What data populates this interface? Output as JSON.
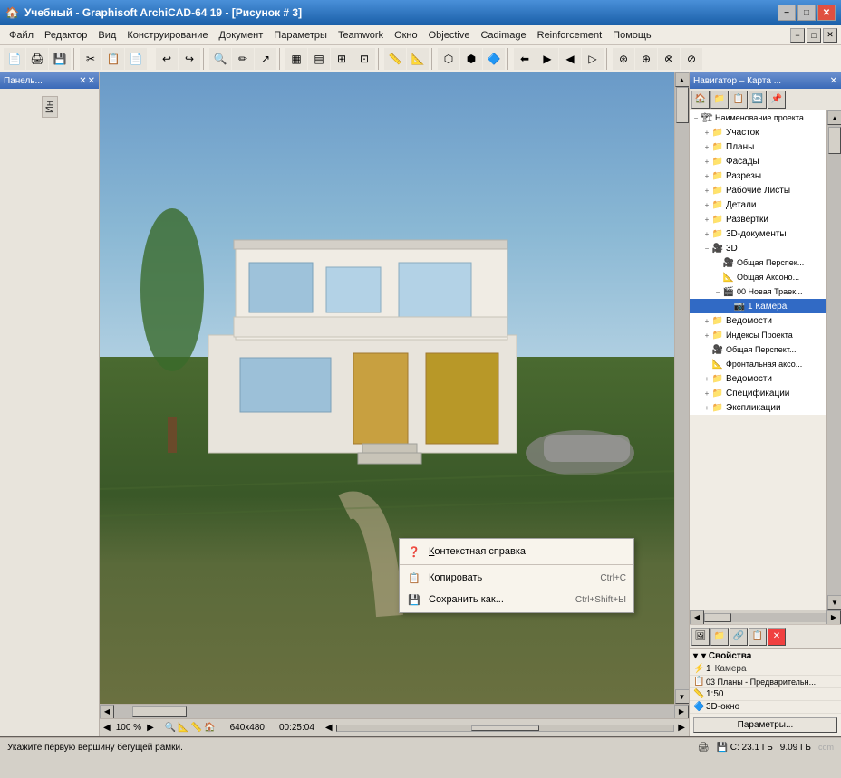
{
  "titleBar": {
    "title": "Учебный - Graphisoft ArchiCAD-64 19 - [Рисунок # 3]",
    "icon": "🏠",
    "controls": [
      "−",
      "□",
      "✕"
    ]
  },
  "menuBar": {
    "items": [
      "Файл",
      "Редактор",
      "Вид",
      "Конструирование",
      "Документ",
      "Параметры",
      "Teamwork",
      "Окно",
      "Objective",
      "Cadimage",
      "Reinforcement",
      "Помощь"
    ],
    "controls": [
      "−",
      "□",
      "✕"
    ]
  },
  "toolbar": {
    "groups": [
      {
        "icons": [
          "📄",
          "🖨",
          "💾"
        ]
      },
      {
        "icons": [
          "✂",
          "📋",
          "📄"
        ]
      },
      {
        "icons": [
          "↩",
          "↪"
        ]
      },
      {
        "icons": [
          "🔍",
          "✏",
          "↗"
        ]
      },
      {
        "icons": [
          "📐",
          "📏",
          "⊞",
          "⊡",
          "▦",
          "▤"
        ]
      },
      {
        "icons": [
          "📊",
          "📈"
        ]
      },
      {
        "icons": [
          "⬡",
          "⬢",
          "🔷"
        ]
      },
      {
        "icons": [
          "⬅",
          "▶",
          "◀",
          "▷"
        ]
      }
    ]
  },
  "leftPanel": {
    "title": "Панель...",
    "verticalText": "Ин"
  },
  "canvas": {
    "zoomLevel": "100 %",
    "dimensions": "640x480",
    "time": "00:25:04"
  },
  "contextMenu": {
    "items": [
      {
        "icon": "❓",
        "label": "Контекстная справка",
        "labelPrefix": "К",
        "shortcut": "",
        "underline": true
      },
      {
        "icon": "📋",
        "label": "Копировать",
        "shortcut": "Ctrl+C"
      },
      {
        "icon": "💾",
        "label": "Сохранить как...",
        "shortcut": "Ctrl+Shift+Ы"
      }
    ]
  },
  "navigator": {
    "title": "Навигатор – Карта ...",
    "toolbar": [
      "🏠",
      "📁",
      "📋",
      "🔄",
      "📌"
    ],
    "tree": [
      {
        "level": 0,
        "toggle": "−",
        "icon": "🏗",
        "label": "Наименование проекта",
        "expanded": true
      },
      {
        "level": 1,
        "toggle": "+",
        "icon": "📁",
        "label": "Участок"
      },
      {
        "level": 1,
        "toggle": "+",
        "icon": "📁",
        "label": "Планы"
      },
      {
        "level": 1,
        "toggle": "+",
        "icon": "📁",
        "label": "Фасады"
      },
      {
        "level": 1,
        "toggle": "+",
        "icon": "📁",
        "label": "Разрезы"
      },
      {
        "level": 1,
        "toggle": "+",
        "icon": "📁",
        "label": "Рабочие Листы"
      },
      {
        "level": 1,
        "toggle": "+",
        "icon": "📁",
        "label": "Детали"
      },
      {
        "level": 1,
        "toggle": "+",
        "icon": "📁",
        "label": "Развертки"
      },
      {
        "level": 1,
        "toggle": "+",
        "icon": "📁",
        "label": "3D-документы"
      },
      {
        "level": 1,
        "toggle": "−",
        "icon": "📁",
        "label": "3D",
        "expanded": true
      },
      {
        "level": 2,
        "toggle": "",
        "icon": "🎥",
        "label": "Общая Перспек..."
      },
      {
        "level": 2,
        "toggle": "",
        "icon": "📐",
        "label": "Общая Аксоно..."
      },
      {
        "level": 2,
        "toggle": "−",
        "icon": "🎬",
        "label": "00 Новая Траек...",
        "expanded": true
      },
      {
        "level": 3,
        "toggle": "",
        "icon": "📷",
        "label": "1 Камера",
        "selected": true
      },
      {
        "level": 1,
        "toggle": "+",
        "icon": "📁",
        "label": "Ведомости"
      },
      {
        "level": 1,
        "toggle": "+",
        "icon": "📁",
        "label": "Индексы Проекта"
      },
      {
        "level": 1,
        "toggle": "",
        "icon": "🎥",
        "label": "Общая Перспект..."
      },
      {
        "level": 1,
        "toggle": "",
        "icon": "📐",
        "label": "Фронтальная аксо..."
      },
      {
        "level": 1,
        "toggle": "+",
        "icon": "📁",
        "label": "Ведомости"
      },
      {
        "level": 1,
        "toggle": "+",
        "icon": "📁",
        "label": "Спецификации"
      },
      {
        "level": 1,
        "toggle": "+",
        "icon": "📁",
        "label": "Экспликации"
      }
    ],
    "bottomToolbar": [
      "🖼",
      "📁",
      "🔗",
      "📋",
      "❌"
    ],
    "properties": {
      "title": "▾ Свойства",
      "rows": [
        {
          "icon": "⚡",
          "key": "1",
          "val": "Камера"
        },
        {
          "icon": "📋",
          "key": "03 Планы - Предварительн..."
        },
        {
          "icon": "📏",
          "key": "1:50"
        },
        {
          "icon": "🔷",
          "key": "3D-окно"
        }
      ],
      "paramsBtn": "Параметры..."
    }
  },
  "statusBar": {
    "message": "Укажите первую вершину бегущей рамки.",
    "diskIcon": "💾",
    "diskInfo": "C: 23.1 ГБ",
    "ramInfo": "9.09 ГБ",
    "watermark": "com"
  }
}
